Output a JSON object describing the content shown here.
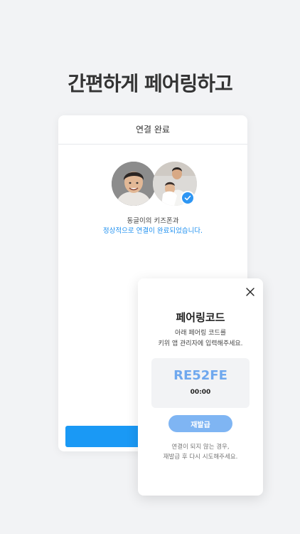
{
  "headline": "간편하게 페어링하고",
  "phone": {
    "header_title": "연결 완료",
    "status_line1": "동글이의 키즈폰과",
    "status_line2": "정상적으로 연결이 완료되었습니다."
  },
  "modal": {
    "title": "페어링코드",
    "desc_line1": "아래 페어링 코드를",
    "desc_line2": "키위 앱 관리자에 입력해주세요.",
    "code": "RE52FE",
    "timer": "00:00",
    "reissue_label": "재발급",
    "note_line1": "연결이 되지 않는 경우,",
    "note_line2": "재발급 후 다시 시도해주세요."
  },
  "colors": {
    "accent": "#1a99f5",
    "code_text": "#6fa8ee",
    "reissue_button": "#7fb5f3",
    "status_blue": "#1e90f0"
  },
  "icons": [
    "close-icon",
    "check-icon"
  ]
}
